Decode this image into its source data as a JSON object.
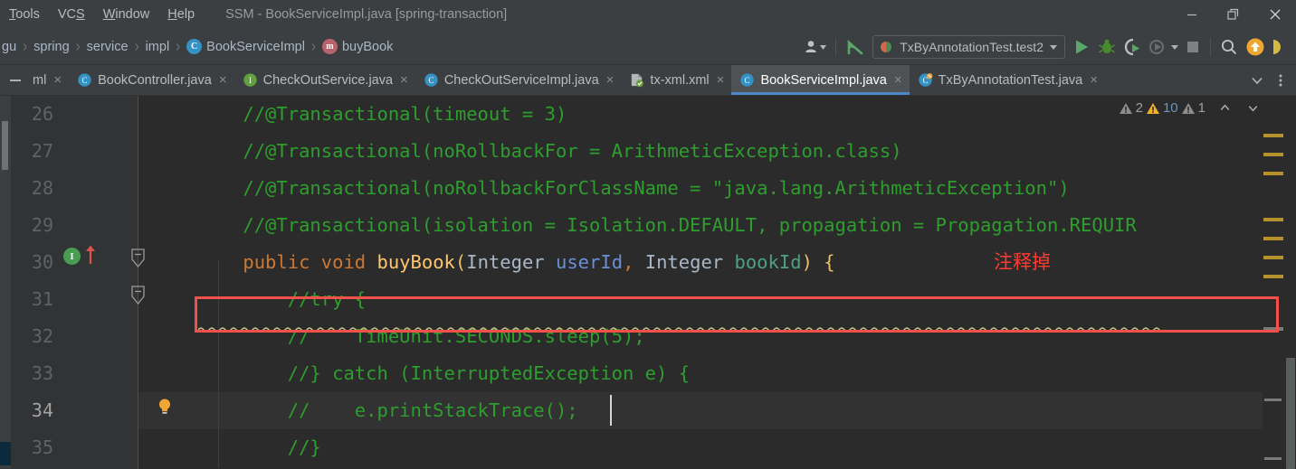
{
  "window": {
    "title": "SSM - BookServiceImpl.java [spring-transaction]",
    "controls": {
      "minimize": "minimize-icon",
      "restore": "restore-icon",
      "close": "close-icon"
    }
  },
  "menubar": {
    "items": [
      {
        "label": "Tools",
        "mnemonic": "T"
      },
      {
        "label": "VCS",
        "mnemonic": "S"
      },
      {
        "label": "Window",
        "mnemonic": "W"
      },
      {
        "label": "Help",
        "mnemonic": "H"
      }
    ]
  },
  "breadcrumb": {
    "separator": "›",
    "items": [
      {
        "label": "gu",
        "icon": null
      },
      {
        "label": "spring",
        "icon": null
      },
      {
        "label": "service",
        "icon": null
      },
      {
        "label": "impl",
        "icon": null
      },
      {
        "label": "BookServiceImpl",
        "icon": "class-icon",
        "icon_letter": "C"
      },
      {
        "label": "buyBook",
        "icon": "method-icon",
        "icon_letter": "m"
      }
    ]
  },
  "toolbar": {
    "user_icon": "user-silhouette-icon",
    "update_project_icon": "vcs-update-arrow-icon",
    "run_config": {
      "label": "TxByAnnotationTest.test2",
      "icon": "run-config-test-icon",
      "dropdown_icon": "chevron-down-icon"
    },
    "run_icon": "run-play-icon",
    "debug_icon": "debug-bug-icon",
    "run_coverage_icon": "run-with-coverage-icon",
    "profile_icon": "profiler-icon",
    "stop_icon": "stop-square-icon",
    "search_icon": "search-magnifier-icon",
    "update_icon": "update-available-arrow-icon"
  },
  "tabs": {
    "collapse_icon": "collapse-minus-icon",
    "list_icon": "chevron-down-icon",
    "more_icon": "more-vertical-dots-icon",
    "items": [
      {
        "label": "ml",
        "icon": "xml-file-icon",
        "active": false,
        "truncated": true
      },
      {
        "label": "BookController.java",
        "icon": "class-icon",
        "icon_letter": "C",
        "active": false
      },
      {
        "label": "CheckOutService.java",
        "icon": "interface-icon",
        "icon_letter": "I",
        "active": false
      },
      {
        "label": "CheckOutServiceImpl.java",
        "icon": "class-icon",
        "icon_letter": "C",
        "active": false
      },
      {
        "label": "tx-xml.xml",
        "icon": "spring-xml-file-icon",
        "active": false
      },
      {
        "label": "BookServiceImpl.java",
        "icon": "class-icon",
        "icon_letter": "C",
        "active": true
      },
      {
        "label": "TxByAnnotationTest.java",
        "icon": "test-class-icon",
        "icon_letter": "C",
        "active": false
      }
    ],
    "close_glyph": "×"
  },
  "inspection_widget": {
    "items": [
      {
        "icon": "warning-triangle-grey-icon",
        "count": "2",
        "color": "#9aa0a6"
      },
      {
        "icon": "warning-triangle-yellow-icon",
        "count": "10",
        "color": "#6897bb"
      },
      {
        "icon": "warning-triangle-grey-icon",
        "count": "1",
        "color": "#9aa0a6"
      }
    ],
    "prev_icon": "chevron-up-icon",
    "next_icon": "chevron-down-icon"
  },
  "editor": {
    "current_line": 34,
    "annotation": {
      "text": "注释掉",
      "color": "#ff3b30",
      "box_color": "#f4504a",
      "boxed_line": 29
    },
    "lines": [
      {
        "number": "26",
        "tokens": [
          {
            "text": "    //@Transactional(timeout = 3)",
            "type": "comment"
          }
        ]
      },
      {
        "number": "27",
        "tokens": [
          {
            "text": "    //@Transactional(noRollbackFor = ArithmeticException.class)",
            "type": "comment"
          }
        ]
      },
      {
        "number": "28",
        "tokens": [
          {
            "text": "    //@Transactional(noRollbackForClassName = \"java.lang.ArithmeticException\")",
            "type": "comment"
          }
        ]
      },
      {
        "number": "29",
        "tokens": [
          {
            "text": "    //@Transactional(isolation = Isolation.DEFAULT, propagation = Propagation.REQUIR",
            "type": "comment"
          }
        ]
      },
      {
        "number": "30",
        "gutter_icons": [
          "implemented-method-icon",
          "override-arrow-icon",
          "fold-collapse-icon"
        ],
        "tokens": [
          {
            "text": "    ",
            "type": "plain"
          },
          {
            "text": "public",
            "type": "keyword"
          },
          {
            "text": " ",
            "type": "plain"
          },
          {
            "text": "void",
            "type": "keyword"
          },
          {
            "text": " ",
            "type": "plain"
          },
          {
            "text": "buyBook",
            "type": "method"
          },
          {
            "text": "(",
            "type": "brace"
          },
          {
            "text": "Integer",
            "type": "type"
          },
          {
            "text": " ",
            "type": "plain"
          },
          {
            "text": "userId",
            "type": "param"
          },
          {
            "text": ",",
            "type": "keyword"
          },
          {
            "text": " ",
            "type": "plain"
          },
          {
            "text": "Integer",
            "type": "type"
          },
          {
            "text": " ",
            "type": "plain"
          },
          {
            "text": "bookId",
            "type": "green"
          },
          {
            "text": ")",
            "type": "brace"
          },
          {
            "text": " ",
            "type": "plain"
          },
          {
            "text": "{",
            "type": "brace"
          }
        ]
      },
      {
        "number": "31",
        "gutter_icons": [
          "fold-collapse-icon"
        ],
        "tokens": [
          {
            "text": "        //try {",
            "type": "comment"
          }
        ]
      },
      {
        "number": "32",
        "tokens": [
          {
            "text": "        //    TimeUnit.SECONDS.sleep(5);",
            "type": "comment"
          }
        ]
      },
      {
        "number": "33",
        "tokens": [
          {
            "text": "        //} catch (InterruptedException e) {",
            "type": "comment"
          }
        ]
      },
      {
        "number": "34",
        "gutter_icons": [
          "intention-bulb-icon"
        ],
        "tokens": [
          {
            "text": "        //    e.printStackTrace();",
            "type": "comment"
          }
        ]
      },
      {
        "number": "35",
        "tokens": [
          {
            "text": "        //}",
            "type": "comment"
          }
        ]
      }
    ]
  },
  "colors": {
    "editor_bg": "#2b2b2b",
    "gutter_bg": "#313335",
    "chrome_bg": "#3c3f41",
    "comment_green": "#2e9e2e",
    "keyword_orange": "#cc7832",
    "method_yellow": "#ffc66d",
    "param_blue": "#6a8fd6",
    "accent_blue": "#4a88c7",
    "marker_yellow": "#b5922b",
    "annotation_red": "#ff3b30"
  }
}
